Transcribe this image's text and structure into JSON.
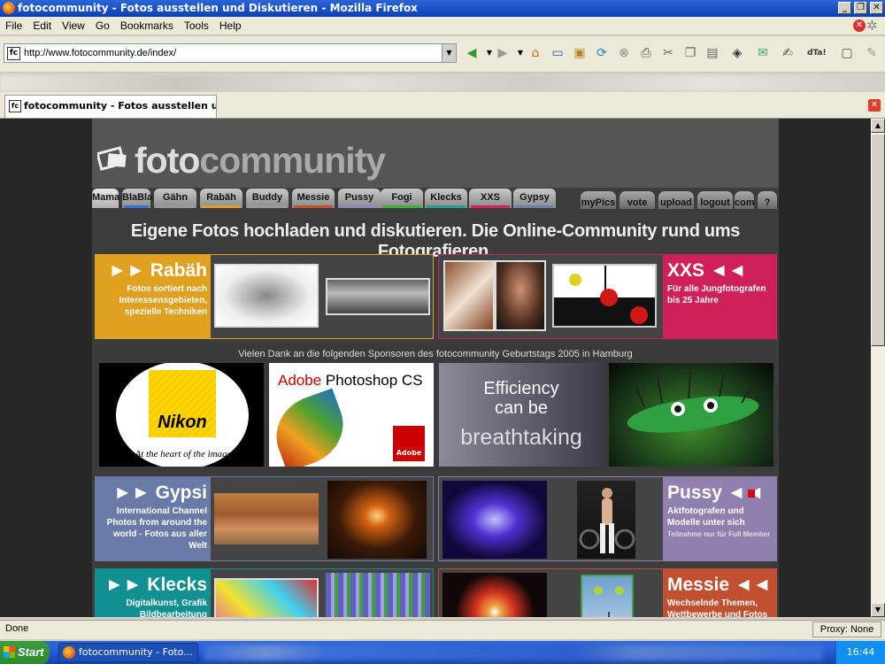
{
  "window": {
    "title": "fotocommunity - Fotos ausstellen und Diskutieren - Mozilla Firefox"
  },
  "menu": [
    "File",
    "Edit",
    "View",
    "Go",
    "Bookmarks",
    "Tools",
    "Help"
  ],
  "address": {
    "url": "http://www.fotocommunity.de/index/"
  },
  "tab": {
    "title": "fotocommunity - Fotos ausstellen un..."
  },
  "site": {
    "logo_a": "foto",
    "logo_b": "community",
    "nav": [
      {
        "label": "Mama",
        "color": "#cccccc"
      },
      {
        "label": "BlaBla",
        "color": "#3a6fd8"
      },
      {
        "label": "Gähn",
        "color": "#9a9a9a"
      },
      {
        "label": "Rabäh",
        "color": "#e0a020"
      },
      {
        "label": "Buddy",
        "color": "#9a9a9a"
      },
      {
        "label": "Messie",
        "color": "#c05030"
      },
      {
        "label": "Pussy",
        "color": "#9a80c0"
      },
      {
        "label": "Fogi",
        "color": "#40b040"
      },
      {
        "label": "Klecks",
        "color": "#20a090"
      },
      {
        "label": "XXS",
        "color": "#d0205a"
      },
      {
        "label": "Gypsy",
        "color": "#6a80b0"
      }
    ],
    "nav_right": [
      "myPics",
      "vote",
      "upload",
      "logout",
      "com",
      "?"
    ],
    "tagline": "Eigene Fotos hochladen und diskutieren. Die Online-Community rund ums Fotografieren.",
    "boxes": {
      "rabaeh": {
        "title": "►► Rabäh",
        "text": "Fotos sortiert nach Interessensgebieten, spezielle Techniken",
        "color": "#e0a020"
      },
      "xxs": {
        "title": "XXS ◄◄",
        "text": "Für alle Jungfotografen bis 25 Jahre",
        "color": "#d0205a"
      },
      "gypsi": {
        "title": "►► Gypsi",
        "text": "International Channel Photos from around the world - Fotos aus aller Welt",
        "color": "#6a7aa8"
      },
      "pussy": {
        "title": "Pussy ◄◄",
        "text": "Aktfotografen und Modelle unter sich",
        "subtext": "Teilnahme nur für Full Member",
        "color": "#9080b0"
      },
      "klecks": {
        "title": "►► Klecks",
        "text": "Digitalkunst, Grafik Bildbearbeitung",
        "color": "#109090"
      },
      "messie": {
        "title": "Messie ◄◄",
        "text": "Wechselnde Themen, Wettbewerbe und Fotos",
        "color": "#c05030"
      }
    },
    "sponsor": {
      "text": "Vielen Dank an die folgenden Sponsoren des fotocommunity Geburtstags 2005 in Hamburg",
      "nikon": "Nikon",
      "nikon_slogan": "At the heart of the image",
      "adobe_a": "Adobe",
      "adobe_b": "Photoshop CS",
      "adobe_logo": "Adobe",
      "eff_1": "Efficiency",
      "eff_2": "can be",
      "eff_3": "breathtaking"
    }
  },
  "status": {
    "text": "Done",
    "proxy": "Proxy: None"
  },
  "taskbar": {
    "start": "Start",
    "task": "fotocommunity - Foto...",
    "clock": "16:44"
  }
}
